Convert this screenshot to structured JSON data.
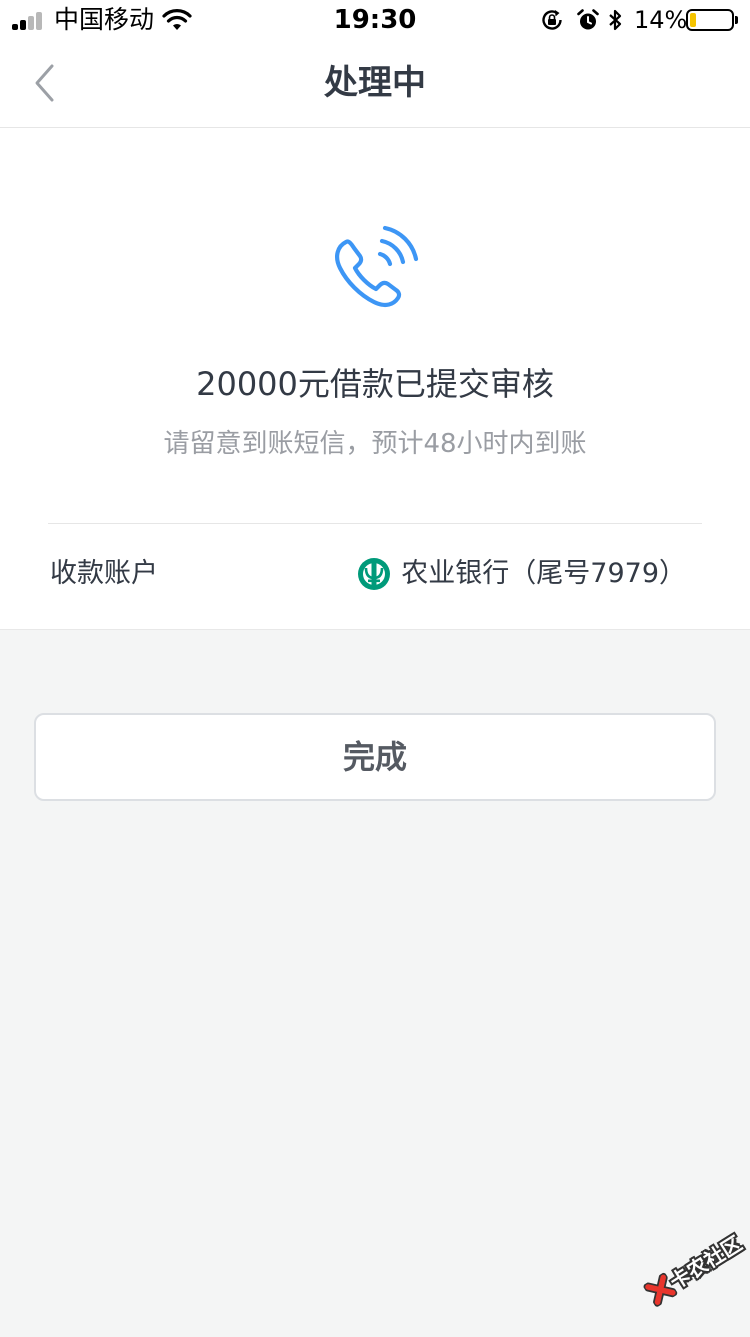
{
  "status_bar": {
    "carrier": "中国移动",
    "time": "19:30",
    "battery_percent": "14%",
    "battery_level": 0.14,
    "icons": [
      "signal-icon",
      "wifi-icon",
      "rotation-lock-icon",
      "alarm-icon",
      "bluetooth-icon",
      "battery-icon"
    ]
  },
  "nav": {
    "title": "处理中",
    "back_icon": "chevron-left-icon"
  },
  "result": {
    "icon": "phone-call-icon",
    "title": "20000元借款已提交审核",
    "subtitle": "请留意到账短信，预计48小时内到账"
  },
  "account": {
    "label": "收款账户",
    "bank_icon": "agricultural-bank-logo",
    "bank_text": "农业银行（尾号7979）"
  },
  "actions": {
    "done_label": "完成"
  },
  "watermark": {
    "text": "卡农社区"
  },
  "colors": {
    "accent_blue": "#3d96f5",
    "bank_green": "#009a7a",
    "battery_yellow": "#f5c400",
    "text_dark": "#333a45",
    "text_muted": "#9a9da3",
    "page_background": "#f4f5f5"
  }
}
